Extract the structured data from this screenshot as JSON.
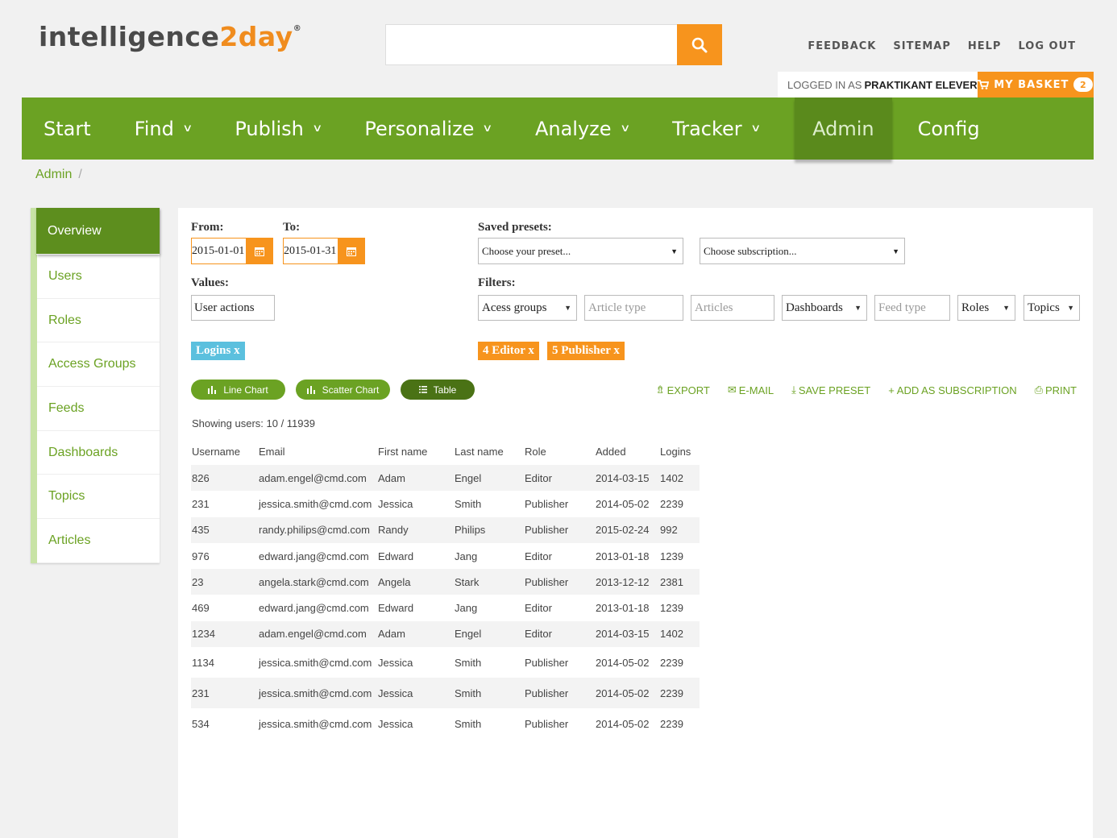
{
  "brand": {
    "name_part1": "intelligence",
    "name_part2": "2day",
    "registered": "®",
    "orange": "#f7941d",
    "green": "#6ba223"
  },
  "search": {
    "placeholder": "",
    "icon": "search-icon"
  },
  "top_links": [
    "FEEDBACK",
    "SITEMAP",
    "HELP",
    "LOG OUT"
  ],
  "session": {
    "logged_in_label": "LOGGED IN AS",
    "user": "PRAKTIKANT ELEVER",
    "basket_label": "MY BASKET",
    "basket_count": "2"
  },
  "nav": [
    {
      "label": "Start",
      "dropdown": false
    },
    {
      "label": "Find",
      "dropdown": true
    },
    {
      "label": "Publish",
      "dropdown": true
    },
    {
      "label": "Personalize",
      "dropdown": true
    },
    {
      "label": "Analyze",
      "dropdown": true
    },
    {
      "label": "Tracker",
      "dropdown": true
    },
    {
      "label": "Admin",
      "dropdown": false,
      "active": true
    },
    {
      "label": "Config",
      "dropdown": false
    }
  ],
  "breadcrumb": {
    "item": "Admin",
    "sep": "/"
  },
  "sidebar": [
    "Overview",
    "Users",
    "Roles",
    "Access Groups",
    "Feeds",
    "Dashboards",
    "Topics",
    "Articles"
  ],
  "form": {
    "from_label": "From:",
    "from_value": "2015-01-01",
    "to_label": "To:",
    "to_value": "2015-01-31",
    "presets_label": "Saved presets:",
    "preset_placeholder": "Choose your preset...",
    "subscription_placeholder": "Choose subscription...",
    "values_label": "Values:",
    "values_value": "User actions",
    "filters_label": "Filters:",
    "filters": [
      "Acess groups",
      "Article type",
      "Articles",
      "Dashboards",
      "Feed type",
      "Roles",
      "Topics"
    ]
  },
  "tags": {
    "value_tag": "Logins x",
    "filter_tag1": "4 Editor x",
    "filter_tag2": "5 Publisher x"
  },
  "view_buttons": [
    "Line Chart",
    "Scatter Chart",
    "Table"
  ],
  "actions": [
    "EXPORT",
    "E-MAIL",
    "SAVE PRESET",
    "ADD AS SUBSCRIPTION",
    "PRINT"
  ],
  "showing": "Showing users: 10 / 11939",
  "table": {
    "headers": [
      "Username",
      "Email",
      "First name",
      "Last name",
      "Role",
      "Added",
      "Logins"
    ],
    "rows": [
      [
        "826",
        "adam.engel@cmd.com",
        "Adam",
        "Engel",
        "Editor",
        "2014-03-15",
        "1402"
      ],
      [
        "231",
        "jessica.smith@cmd.com",
        "Jessica",
        "Smith",
        "Publisher",
        "2014-05-02",
        "2239"
      ],
      [
        "435",
        "randy.philips@cmd.com",
        "Randy",
        "Philips",
        "Publisher",
        "2015-02-24",
        "992"
      ],
      [
        "976",
        "edward.jang@cmd.com",
        "Edward",
        "Jang",
        "Editor",
        "2013-01-18",
        "1239"
      ],
      [
        "23",
        "angela.stark@cmd.com",
        "Angela",
        "Stark",
        "Publisher",
        "2013-12-12",
        "2381"
      ],
      [
        "469",
        "edward.jang@cmd.com",
        "Edward",
        "Jang",
        "Editor",
        "2013-01-18",
        "1239"
      ],
      [
        "1234",
        "adam.engel@cmd.com",
        "Adam",
        "Engel",
        "Editor",
        "2014-03-15",
        "1402"
      ],
      [
        "1134",
        "jessica.smith@cmd.com",
        "Jessica",
        "Smith",
        "Publisher",
        "2014-05-02",
        "2239"
      ],
      [
        "231",
        "jessica.smith@cmd.com",
        "Jessica",
        "Smith",
        "Publisher",
        "2014-05-02",
        "2239"
      ],
      [
        "534",
        "jessica.smith@cmd.com",
        "Jessica",
        "Smith",
        "Publisher",
        "2014-05-02",
        "2239"
      ]
    ]
  }
}
